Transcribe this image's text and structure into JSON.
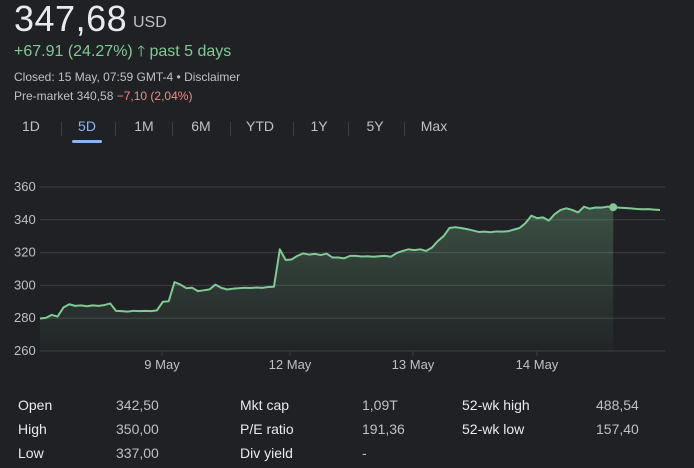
{
  "quote": {
    "price": "347,68",
    "currency": "USD",
    "change": "+67.91 (24.27%)",
    "change_arrow": "🡑",
    "period": "past 5 days",
    "closed_text": "Closed: 15 May, 07:59 GMT-4 •",
    "disclaimer": "Disclaimer",
    "premarket_label": "Pre-market 340,58",
    "premarket_change": "−7,10 (2,04%)"
  },
  "tabs": [
    {
      "label": "1D",
      "active": false
    },
    {
      "label": "5D",
      "active": true
    },
    {
      "label": "1M",
      "active": false
    },
    {
      "label": "6M",
      "active": false
    },
    {
      "label": "YTD",
      "active": false
    },
    {
      "label": "1Y",
      "active": false
    },
    {
      "label": "5Y",
      "active": false
    },
    {
      "label": "Max",
      "active": false
    }
  ],
  "colors": {
    "line": "#81c995",
    "grid": "#3c4043",
    "positive": "#81c995",
    "negative": "#f28b82",
    "accent": "#8ab4f8"
  },
  "chart_data": {
    "type": "area",
    "yticks": [
      "360",
      "340",
      "320",
      "300",
      "280",
      "260"
    ],
    "ylim": [
      260,
      360
    ],
    "xtick_labels": [
      "9 May",
      "12 May",
      "13 May",
      "14 May"
    ],
    "grid": true,
    "series": [
      {
        "values": [
          279.8,
          280.2,
          282.0,
          281.0,
          286.5,
          288.5,
          287.5,
          287.8,
          287.3,
          287.8,
          287.5,
          288.0,
          289.0,
          284.5,
          284.3,
          284.0,
          284.5,
          284.3,
          284.5,
          284.3,
          284.8,
          290.0,
          290.3,
          302.0,
          300.5,
          298.3,
          298.6,
          296.5,
          297.0,
          297.6,
          300.5,
          298.5,
          297.5,
          298.0,
          298.3,
          298.6,
          298.4,
          298.7,
          298.5,
          299.0,
          299.2,
          322.0,
          315.5,
          315.8,
          318.0,
          319.5,
          318.8,
          319.2,
          318.5,
          319.4,
          317.0,
          317.0,
          316.5,
          318.0,
          318.0,
          317.6,
          317.8,
          317.5,
          317.8,
          318.0,
          317.5,
          319.8,
          321.0,
          322.0,
          321.5,
          322.0,
          321.0,
          323.0,
          327.0,
          330.0,
          335.0,
          335.5,
          335.0,
          334.3,
          333.5,
          332.6,
          332.8,
          332.4,
          332.9,
          332.8,
          333.0,
          334.0,
          335.0,
          338.0,
          342.5,
          341.0,
          341.5,
          339.5,
          343.5,
          346.0,
          347.0,
          346.0,
          344.5,
          348.0,
          346.8,
          347.5,
          347.4,
          348.0,
          347.68,
          347.4,
          347.2,
          347.0,
          346.6,
          346.4,
          346.5,
          346.2,
          346.0
        ]
      }
    ],
    "marker_index": 98
  },
  "stats": [
    {
      "label": "Open",
      "value": "342,50"
    },
    {
      "label": "High",
      "value": "350,00"
    },
    {
      "label": "Low",
      "value": "337,00"
    },
    {
      "label": "Mkt cap",
      "value": "1,09T"
    },
    {
      "label": "P/E ratio",
      "value": "191,36"
    },
    {
      "label": "Div yield",
      "value": "-"
    },
    {
      "label": "52-wk high",
      "value": "488,54"
    },
    {
      "label": "52-wk low",
      "value": "157,40"
    }
  ]
}
